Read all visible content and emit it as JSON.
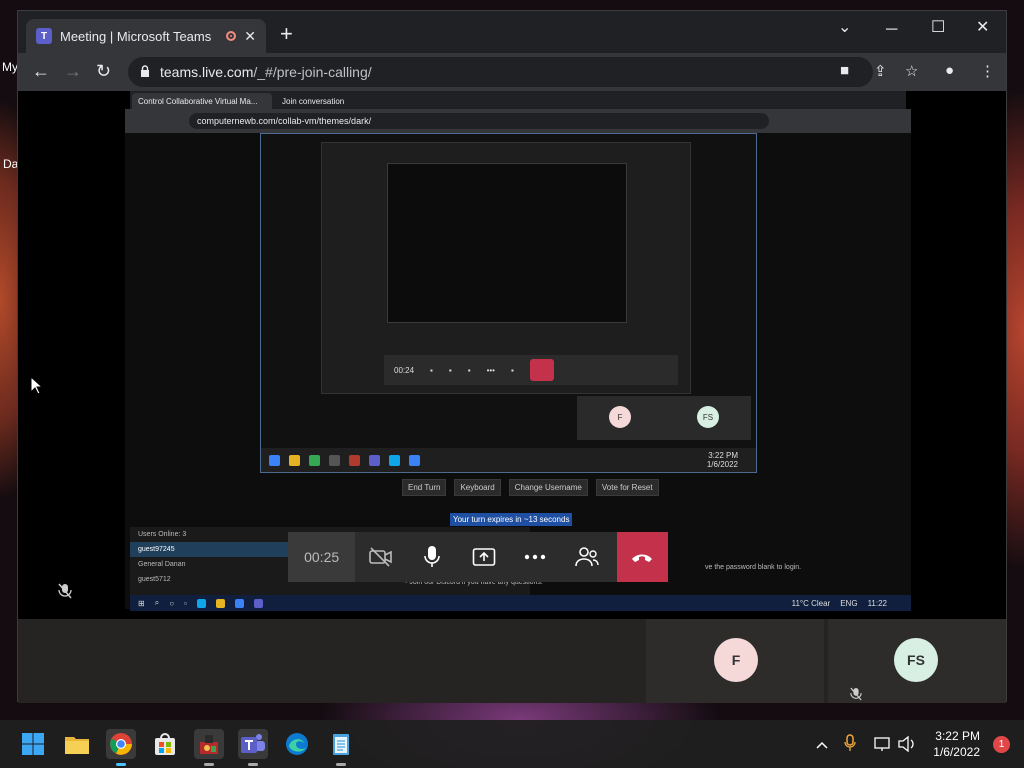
{
  "desktop": {
    "edge_text_1": "My",
    "edge_text_2": "Da"
  },
  "browser": {
    "tab_title": "Meeting | Microsoft Teams",
    "url_host": "teams.live.com",
    "url_path": "/_#/pre-join-calling/"
  },
  "shared_screen": {
    "tab1": "Control Collaborative Virtual Ma...",
    "tab2": "Join conversation",
    "url": "computernewb.com/collab-vm/themes/dark/",
    "vm_buttons": [
      "End Turn",
      "Keyboard",
      "Change Username",
      "Vote for Reset"
    ],
    "turn_text": "Your turn expires in ~13 seconds",
    "users_online": "Users Online: 3",
    "users": [
      "guest97245",
      "General Danan",
      "guest5712"
    ],
    "chat_hint": "Join our Discord if you have any questions.",
    "password_hint": "ve the password blank to login.",
    "vm_weather": "11°C  Clear",
    "vm_lang": "ENG",
    "vm_time": "11:22",
    "nested_time": "3:22 PM",
    "nested_date": "1/6/2022",
    "nested_timer": "00:24"
  },
  "meeting": {
    "timer": "00:25",
    "participants": [
      {
        "initials": "F",
        "color": "#f5d9d8"
      },
      {
        "initials": "FS",
        "color": "#d8efe4"
      }
    ],
    "end_color": "#c4314b"
  },
  "taskbar": {
    "time": "3:22 PM",
    "date": "1/6/2022",
    "notifications": "1"
  }
}
